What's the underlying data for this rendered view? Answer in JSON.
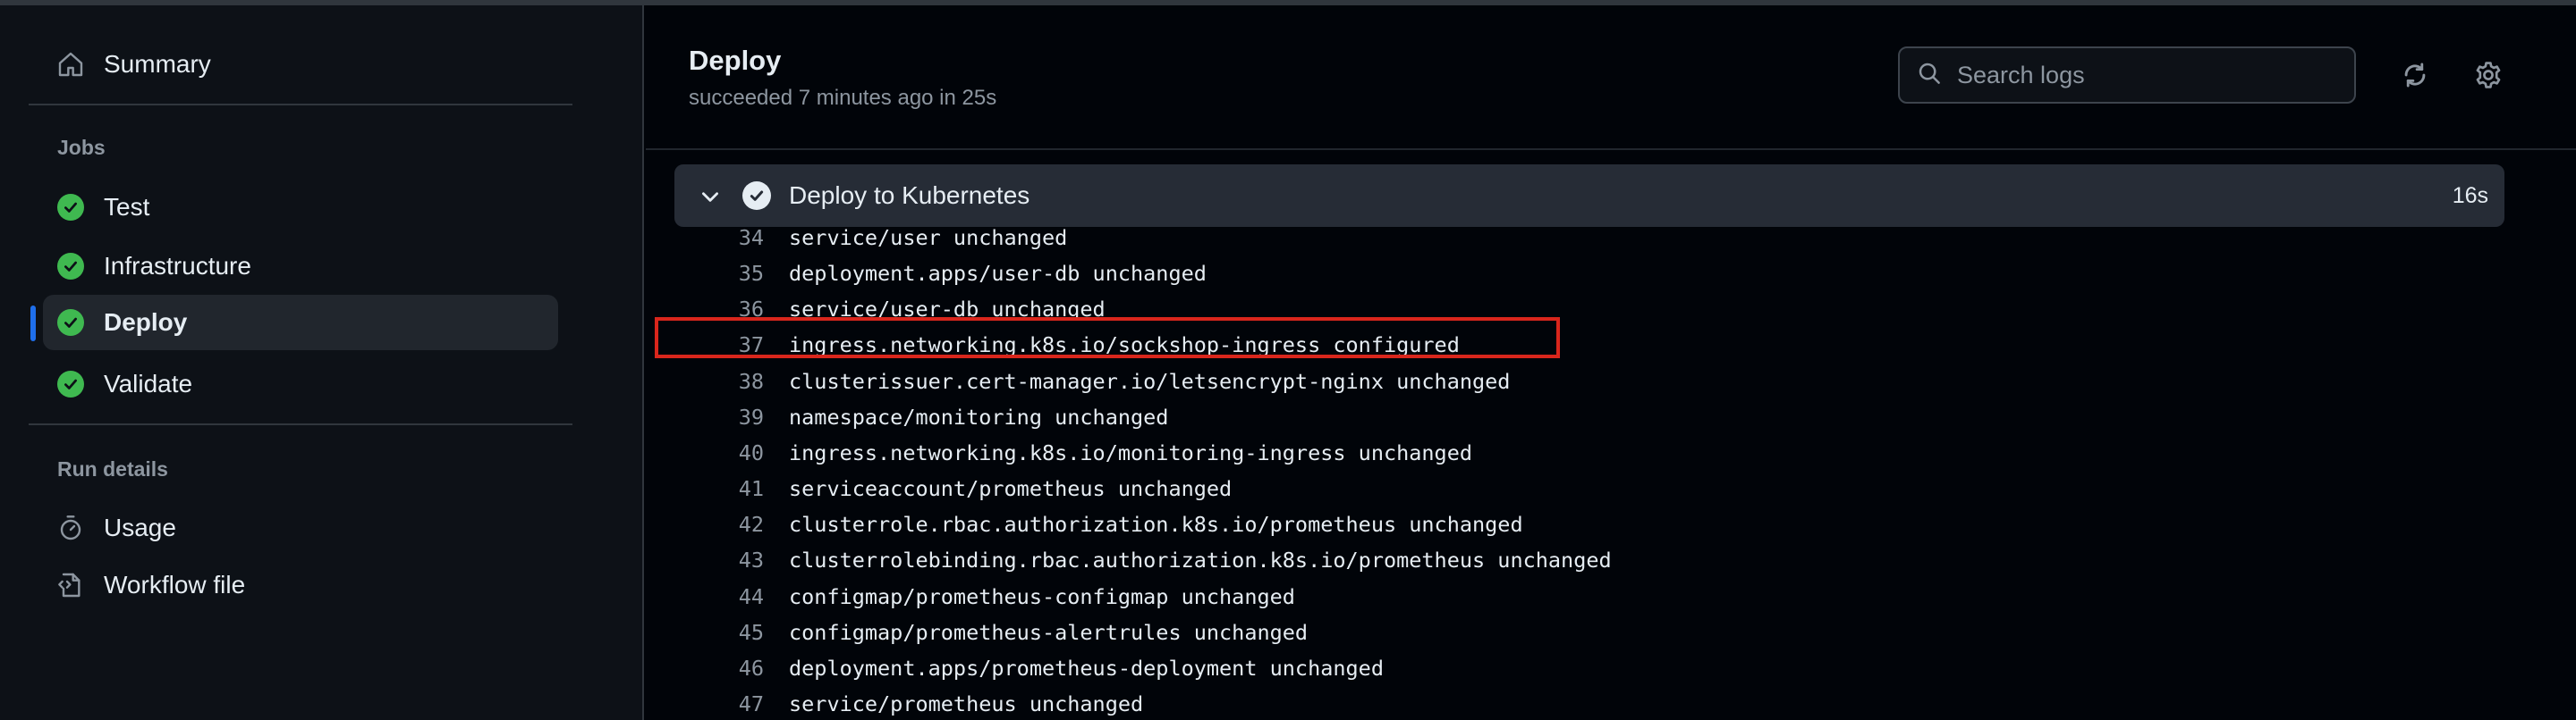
{
  "sidebar": {
    "summary_label": "Summary",
    "jobs_heading": "Jobs",
    "jobs": [
      {
        "label": "Test",
        "status": "success"
      },
      {
        "label": "Infrastructure",
        "status": "success"
      },
      {
        "label": "Deploy",
        "status": "success",
        "active": true
      },
      {
        "label": "Validate",
        "status": "success"
      }
    ],
    "run_details_heading": "Run details",
    "usage_label": "Usage",
    "workflow_file_label": "Workflow file"
  },
  "header": {
    "title": "Deploy",
    "subtitle": "succeeded 7 minutes ago in 25s",
    "search_placeholder": "Search logs"
  },
  "step": {
    "name": "Deploy to Kubernetes",
    "duration": "16s",
    "expanded": true
  },
  "logs": [
    {
      "n": "34",
      "text": "service/user unchanged"
    },
    {
      "n": "35",
      "text": "deployment.apps/user-db unchanged"
    },
    {
      "n": "36",
      "text": "service/user-db unchanged"
    },
    {
      "n": "37",
      "text": "ingress.networking.k8s.io/sockshop-ingress configured"
    },
    {
      "n": "38",
      "text": "clusterissuer.cert-manager.io/letsencrypt-nginx unchanged"
    },
    {
      "n": "39",
      "text": "namespace/monitoring unchanged"
    },
    {
      "n": "40",
      "text": "ingress.networking.k8s.io/monitoring-ingress unchanged"
    },
    {
      "n": "41",
      "text": "serviceaccount/prometheus unchanged"
    },
    {
      "n": "42",
      "text": "clusterrole.rbac.authorization.k8s.io/prometheus unchanged"
    },
    {
      "n": "43",
      "text": "clusterrolebinding.rbac.authorization.k8s.io/prometheus unchanged"
    },
    {
      "n": "44",
      "text": "configmap/prometheus-configmap unchanged"
    },
    {
      "n": "45",
      "text": "configmap/prometheus-alertrules unchanged"
    },
    {
      "n": "46",
      "text": "deployment.apps/prometheus-deployment unchanged"
    },
    {
      "n": "47",
      "text": "service/prometheus unchanged"
    }
  ],
  "highlighted_line": "37",
  "colors": {
    "success": "#3fb950",
    "accent": "#1f6feb",
    "highlight": "#d9261c"
  },
  "icons": {
    "summary": "home-icon",
    "usage": "stopwatch-icon",
    "workflow_file": "file-code-icon",
    "search": "search-icon",
    "refresh": "refresh-icon",
    "settings": "gear-icon",
    "collapse": "chevron-down-icon",
    "step_status": "check-circle-icon"
  }
}
